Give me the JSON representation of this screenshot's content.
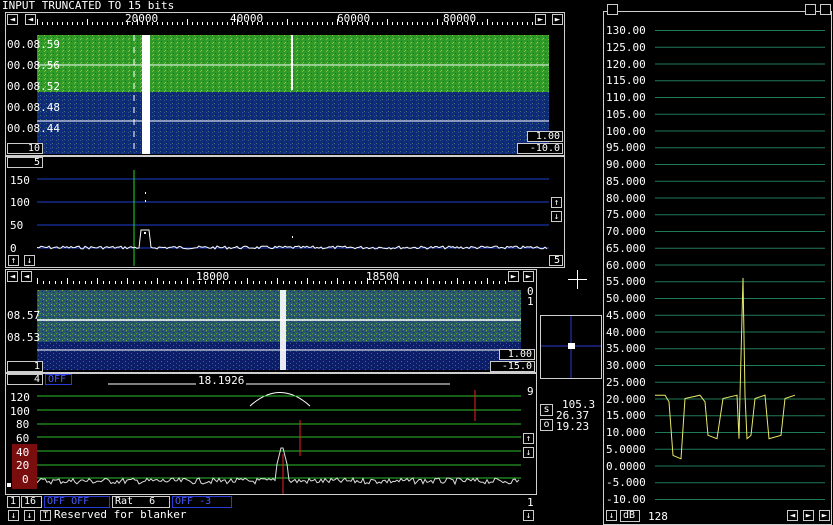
{
  "status": {
    "top": "INPUT TRUNCATED TO 15 bits"
  },
  "wide": {
    "freq_ticks": [
      "20000",
      "40000",
      "60000",
      "80000"
    ],
    "time_labels": [
      "00.08.59",
      "00.08.56",
      "00.08.52",
      "00.08.48",
      "00.08.44"
    ],
    "gain": "1.00",
    "offset": "-10.0",
    "avg": "10",
    "spec_avg": "5",
    "ylabels": [
      "150",
      "100",
      "50",
      "0"
    ],
    "spec_right": "5"
  },
  "narrow": {
    "freq_ticks": [
      "18000",
      "18500"
    ],
    "time_labels": [
      "08.57",
      "08.53"
    ],
    "right_top": [
      "0",
      "1"
    ],
    "gain": "1.00",
    "offset": "-15.0",
    "avg": "1",
    "spec_avg": "4",
    "blue_tag": "OFF",
    "freq_readout": "18.1926",
    "ylabels": [
      "120",
      "100",
      "80",
      "60",
      "40",
      "20",
      "0"
    ],
    "right_val": "9",
    "bottom_right_val": "1"
  },
  "bottom_bar": {
    "v1": "1",
    "v2": "16",
    "blue_a": "OFF OFF",
    "rat_label": "Rat",
    "rat_value": "6",
    "blue_b": "OFF -3",
    "arrows": [
      "↓",
      "↓",
      "T"
    ],
    "message": "Reserved for blanker"
  },
  "scope": {
    "s_label": "s",
    "s_value_top": "105.3",
    "s_value_mid": "26.37",
    "o_label": "o",
    "o_value": "19.23"
  },
  "level": {
    "ylabels": [
      "130.00",
      "125.00",
      "120.00",
      "115.00",
      "110.00",
      "105.00",
      "100.00",
      "95.000",
      "90.000",
      "85.000",
      "80.000",
      "75.000",
      "70.000",
      "65.000",
      "60.000",
      "55.000",
      "50.000",
      "45.000",
      "40.000",
      "35.000",
      "30.000",
      "25.000",
      "20.000",
      "15.000",
      "10.000",
      "5.0000",
      "0.0000",
      "-5.000",
      "-10.00"
    ],
    "unit": "dB",
    "points": "128"
  },
  "icons": {
    "left": "left-arrow-icon",
    "right": "right-arrow-icon",
    "up": "up-arrow-icon",
    "down": "down-arrow-icon"
  }
}
